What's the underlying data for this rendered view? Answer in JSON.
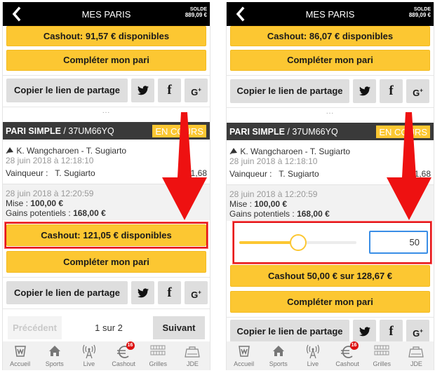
{
  "header": {
    "title": "MES PARIS",
    "solde_label": "SOLDE",
    "solde_value": "889,09 €"
  },
  "share": {
    "copy_label": "Copier le lien de partage",
    "twitter": "twitter-icon",
    "facebook": "facebook-icon",
    "googleplus": "google-plus-icon"
  },
  "common": {
    "completer_label": "Compléter mon pari",
    "ellipsis": "..."
  },
  "bet": {
    "type": "PARI SIMPLE",
    "ref": " / 37UM66YQ",
    "status": "EN COURS",
    "sport_icon": "badminton-shuttlecock-icon",
    "match": "K. Wangcharoen - T. Sugiarto",
    "match_date": "28 juin 2018 à 12:18:10",
    "market_label": "Vainqueur :",
    "selection": "T. Sugiarto",
    "odds": "1,68",
    "bet_date": "28 juin 2018 à 12:20:59",
    "mise_label": "Mise  : ",
    "mise_value": "100,00 €",
    "gains_label": "Gains potentiels  : ",
    "gains_value": "168,00 €"
  },
  "left": {
    "top_cashout": "Cashout: 91,57 € disponibles",
    "cashout": "Cashout: 121,05 € disponibles",
    "pager": {
      "prev": "Précédent",
      "info": "1 sur 2",
      "next": "Suivant"
    }
  },
  "right": {
    "top_cashout": "Cashout: 86,07 € disponibles",
    "slider_percent": 50,
    "amount_input": "50",
    "cashout_partial": "Cashout 50,00 € sur 128,67 €"
  },
  "nav": {
    "items": [
      {
        "label": "Accueil",
        "icon": "home-logo-icon"
      },
      {
        "label": "Sports",
        "icon": "house-icon"
      },
      {
        "label": "Live",
        "icon": "antenna-icon"
      },
      {
        "label": "Cashout",
        "icon": "euro-icon",
        "badge": "16"
      },
      {
        "label": "Grilles",
        "icon": "grid-icon"
      },
      {
        "label": "JDE",
        "icon": "stadium-icon"
      }
    ]
  },
  "colors": {
    "accent": "#fcc732",
    "header_bg": "#000000",
    "bet_header_bg": "#3a3a3a",
    "highlight": "#e4161b",
    "input_border": "#3a8ee6",
    "badge": "#dd1111"
  }
}
